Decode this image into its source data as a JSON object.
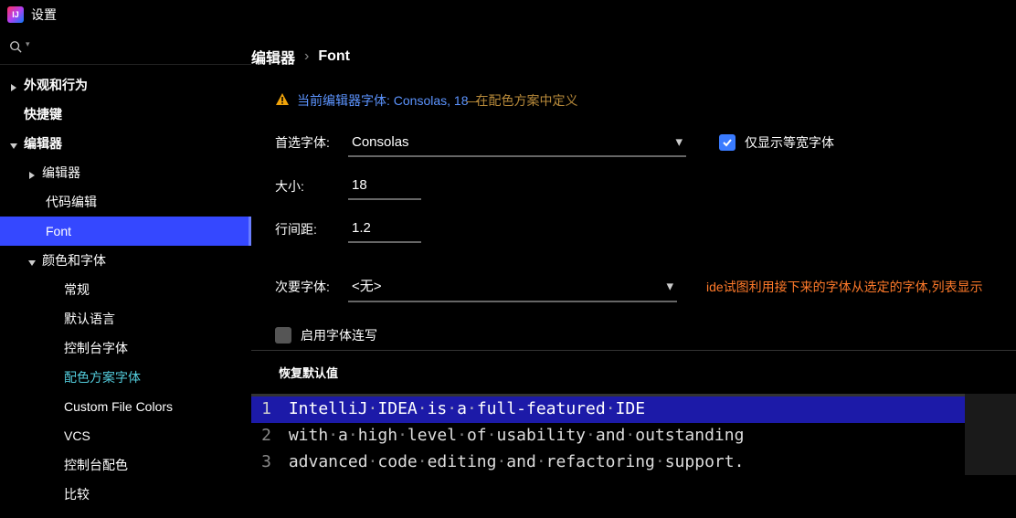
{
  "titlebar": {
    "app_abbr": "IJ",
    "title": "设置"
  },
  "search": {
    "placeholder": ""
  },
  "tree": {
    "appearance": "外观和行为",
    "keymap": "快捷键",
    "editor": "编辑器",
    "editor_sub": "编辑器",
    "code_editing": "代码编辑",
    "font": "Font",
    "color_font": "颜色和字体",
    "general": "常规",
    "default_lang": "默认语言",
    "console_font": "控制台字体",
    "scheme_font": "配色方案字体",
    "custom_file_colors": "Custom File Colors",
    "vcs": "VCS",
    "console_colors": "控制台配色",
    "compare": "比较"
  },
  "breadcrumb": {
    "a": "编辑器",
    "b": "Font"
  },
  "warning": {
    "prefix": "当前编辑器字体: Consolas, 18",
    "dash": " — ",
    "suffix": "在配色方案中定义"
  },
  "form": {
    "font_label": "首选字体:",
    "font_value": "Consolas",
    "mono_only": "仅显示等宽字体",
    "size_label": "大小:",
    "size_value": "18",
    "line_spacing_label": "行间距:",
    "line_spacing_value": "1.2",
    "secondary_label": "次要字体:",
    "secondary_value": "<无>",
    "secondary_hint": "ide试图利用接下来的字体从选定的字体,列表显示",
    "ligatures": "启用字体连写"
  },
  "restore": "恢复默认值",
  "preview": {
    "l1": "IntelliJ IDEA is a full-featured IDE",
    "l2": "with a high level of usability and outstanding",
    "l3": "advanced code editing and refactoring support."
  }
}
